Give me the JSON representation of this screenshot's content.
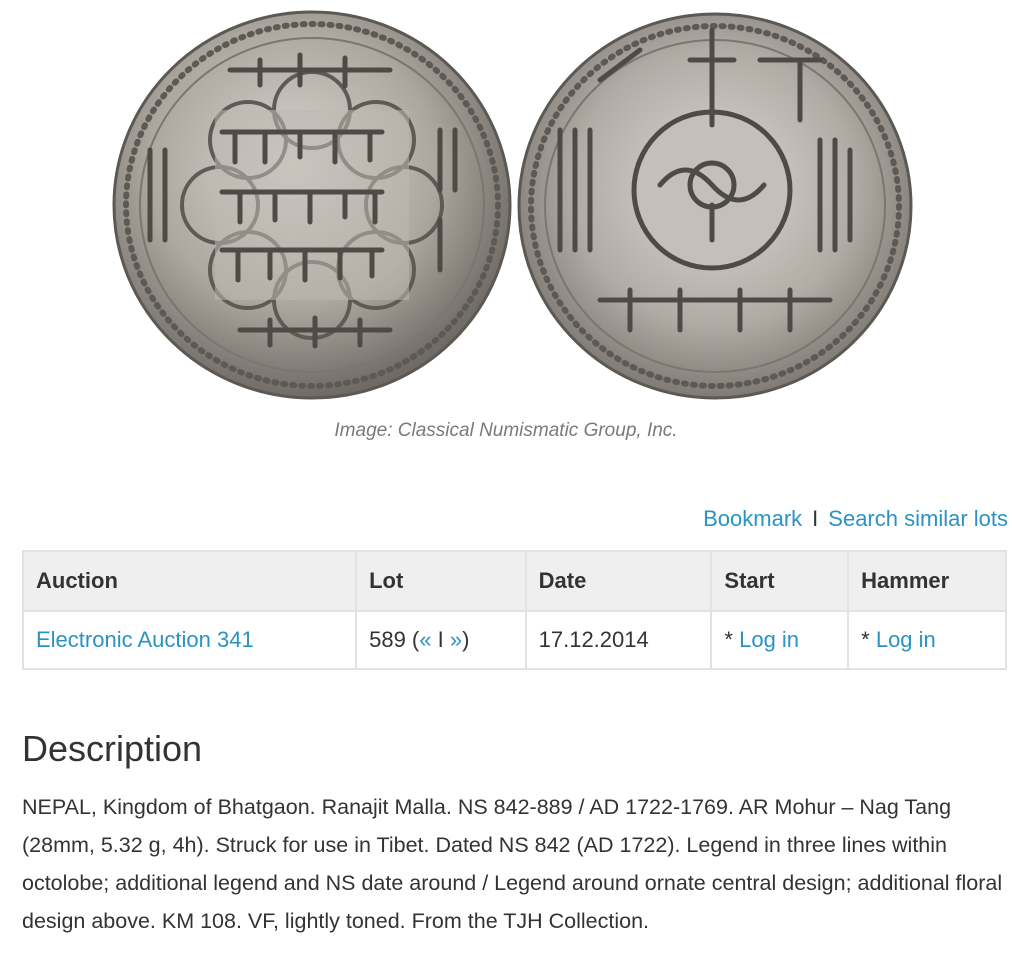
{
  "image": {
    "caption": "Image: Classical Numismatic Group, Inc.",
    "obverse_icon": "coin-obverse",
    "reverse_icon": "coin-reverse"
  },
  "actions": {
    "bookmark": "Bookmark",
    "separator": "I",
    "search_similar": "Search similar lots"
  },
  "table": {
    "headers": [
      "Auction",
      "Lot",
      "Date",
      "Start",
      "Hammer"
    ],
    "row": {
      "auction": "Electronic Auction 341",
      "lot_number": "589",
      "lot_prev": "«",
      "lot_sep": "I",
      "lot_next": "»",
      "date": "17.12.2014",
      "start_prefix": "*",
      "start_link": "Log in",
      "hammer_prefix": "*",
      "hammer_link": "Log in"
    }
  },
  "description": {
    "title": "Description",
    "text": "NEPAL, Kingdom of Bhatgaon. Ranajit Malla. NS 842-889 / AD 1722-1769. AR Mohur – Nag Tang (28mm, 5.32 g, 4h). Struck for use in Tibet. Dated NS 842 (AD 1722). Legend in three lines within octolobe; additional legend and NS date around / Legend around ornate central design; additional floral design above. KM 108. VF, lightly toned. From the TJH Collection."
  },
  "colors": {
    "link": "#2a93c4",
    "text": "#333333",
    "caption": "#7a7a7a",
    "table_header_bg": "#efefef",
    "coin_silver": "#b9b4ad"
  }
}
